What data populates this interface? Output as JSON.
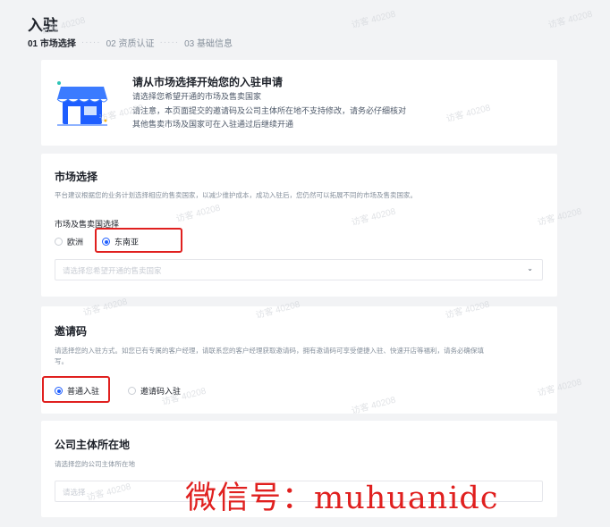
{
  "header": {
    "title": "入驻",
    "steps": [
      {
        "label": "01 市场选择",
        "active": true
      },
      {
        "label": "02 资质认证",
        "active": false
      },
      {
        "label": "03 基础信息",
        "active": false
      }
    ],
    "step_separator": "·····"
  },
  "intro": {
    "illustration": "storefront-icon",
    "title": "请从市场选择开始您的入驻申请",
    "lines": [
      "请选择您希望开通的市场及售卖国家",
      "请注意，本页面提交的邀请码及公司主体所在地不支持修改，请务必仔细核对",
      "其他售卖市场及国家可在入驻通过后继续开通"
    ]
  },
  "market": {
    "title": "市场选择",
    "description": "平台建议根据您的业务计划选择相应的售卖国家，以减少维护成本，成功入驻后，您仍然可以拓展不同的市场及售卖国家。",
    "field_label": "市场及售卖国选择",
    "options": [
      {
        "label": "欧洲",
        "checked": false
      },
      {
        "label": "东南亚",
        "checked": true
      }
    ],
    "country_select_placeholder": "请选择您希望开通的售卖国家"
  },
  "invite": {
    "title": "邀请码",
    "description_line1": "请选择您的入驻方式。如您已有专属的客户经理，请联系您的客户经理获取邀请码，拥有邀请码可享受便捷入驻、快速开店等福利，请务必确保填",
    "description_line2": "写。",
    "options": [
      {
        "label": "普通入驻",
        "checked": true
      },
      {
        "label": "邀请码入驻",
        "checked": false
      }
    ]
  },
  "company": {
    "title": "公司主体所在地",
    "description": "请选择您的公司主体所在地",
    "select_placeholder": "请选择"
  },
  "watermark_text": "访客 40208",
  "overlay_text": "微信号：muhuanidc",
  "colors": {
    "accent": "#1e5eff",
    "highlight": "#e0201f",
    "background": "#f2f3f5"
  }
}
